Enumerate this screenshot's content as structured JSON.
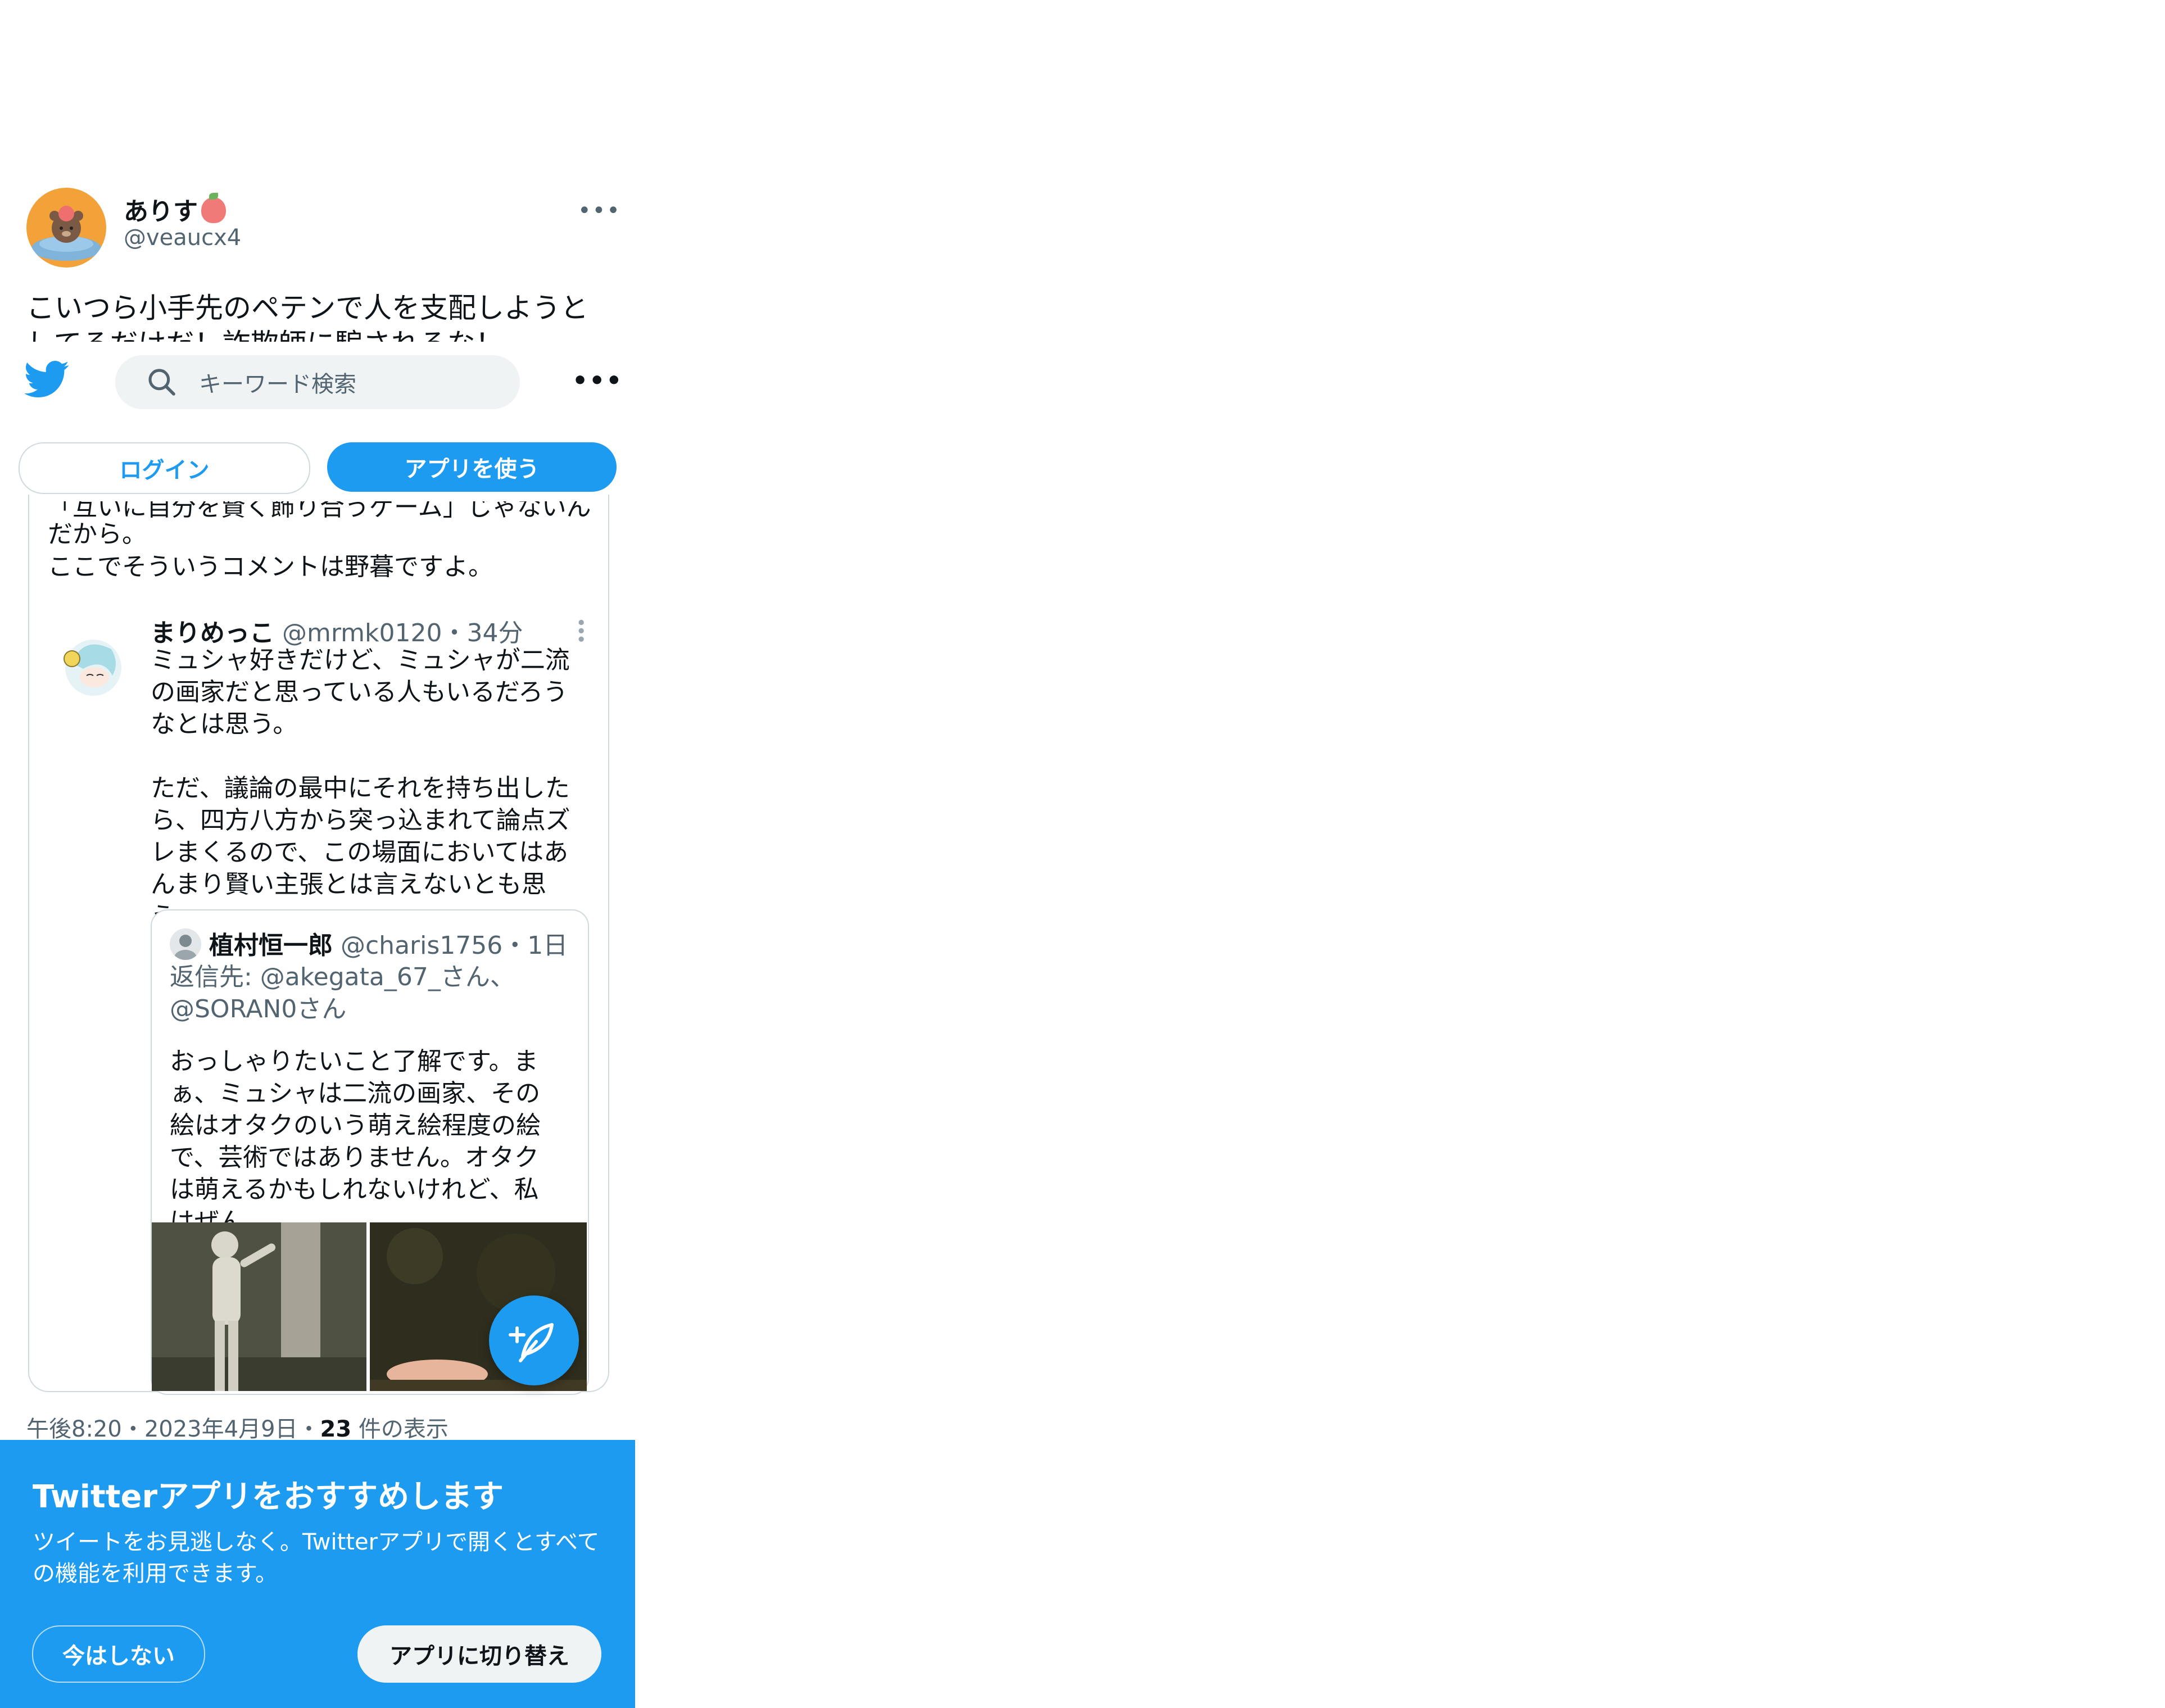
{
  "tweet": {
    "display_name": "ありす",
    "handle": "@veaucx4",
    "text": "こいつら小手先のペテンで人を支配しようとしてるだけだ！詐欺師に騙されるな！",
    "timestamp": "午後8:20・2023年4月9日・",
    "views_count": "23",
    "views_label": " 件の表示"
  },
  "topbar": {
    "search_placeholder": "キーワード検索",
    "more": "•••",
    "login_label": "ログイン",
    "use_app_label": "アプリを使う"
  },
  "quote": {
    "cut_line": "「互いに自分を賢く飾り合うゲーム」じゃないん",
    "line2": "だから。",
    "line3": "ここでそういうコメントは野暮ですよ。",
    "reply": {
      "name": "まりめっこ",
      "handle_time": " @mrmk0120・34分",
      "body": "ミュシャ好きだけど、ミュシャが二流の画家だと思っている人もいるだろうなとは思う。\n\nただ、議論の最中にそれを持ち出したら、四方八方から突っ込まれて論点ズレまくるので、この場面においてはあんまり賢い主張とは言えないとも思う。",
      "dots": "•••"
    },
    "nested": {
      "name": "植村恒一郎",
      "handle_time": " @charis1756・1日",
      "reply_to": "返信先: @akegata_67_さん、@SORAN0さん",
      "body": "おっしゃりたいこと了解です。まぁ、ミュシャは二流の画家、その絵はオタクのいう萌え絵程度の絵で、芸術ではありません。オタクは萌えるかもしれないけれど、私はぜん..."
    }
  },
  "sheet": {
    "title": "Twitterアプリをおすすめします",
    "desc": "ツイートをお見逃しなく。Twitterアプリで開くとすべての機能を利用できます。",
    "not_now": "今はしない",
    "switch": "アプリに切り替え"
  },
  "colors": {
    "accent": "#1d9bf0",
    "text": "#0f1419",
    "secondary": "#536471",
    "border": "#cfd9de"
  }
}
